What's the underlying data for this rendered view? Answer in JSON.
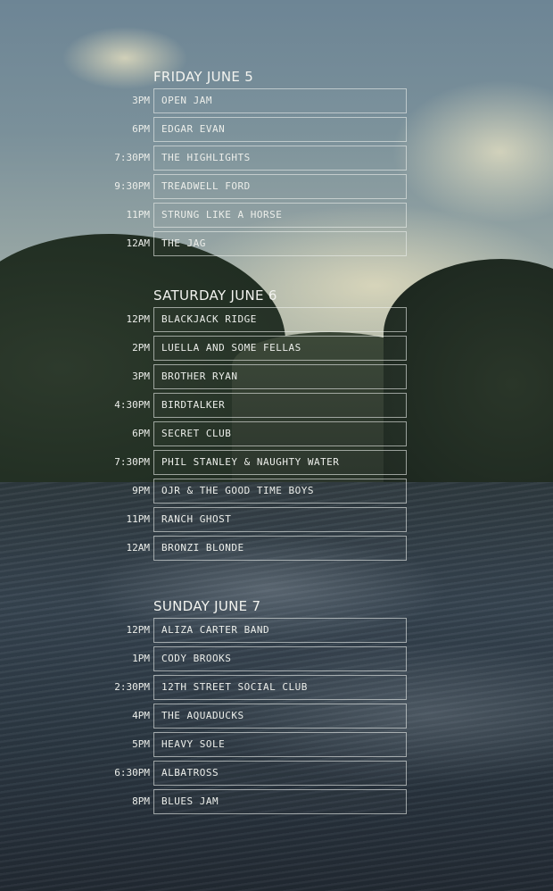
{
  "days": [
    {
      "title": "FRIDAY JUNE 5",
      "slots": [
        {
          "time": "3PM",
          "act": "OPEN JAM"
        },
        {
          "time": "6PM",
          "act": "EDGAR EVAN"
        },
        {
          "time": "7:30PM",
          "act": "THE HIGHLIGHTS"
        },
        {
          "time": "9:30PM",
          "act": "TREADWELL FORD"
        },
        {
          "time": "11PM",
          "act": "STRUNG LIKE A HORSE"
        },
        {
          "time": "12AM",
          "act": "THE JAG"
        }
      ]
    },
    {
      "title": "SATURDAY JUNE 6",
      "slots": [
        {
          "time": "12PM",
          "act": "BLACKJACK RIDGE"
        },
        {
          "time": "2PM",
          "act": "LUELLA AND SOME FELLAS"
        },
        {
          "time": "3PM",
          "act": "BROTHER RYAN"
        },
        {
          "time": "4:30PM",
          "act": "BIRDTALKER"
        },
        {
          "time": "6PM",
          "act": "SECRET CLUB"
        },
        {
          "time": "7:30PM",
          "act": "PHIL STANLEY & NAUGHTY WATER"
        },
        {
          "time": "9PM",
          "act": "OJR & THE GOOD TIME BOYS"
        },
        {
          "time": "11PM",
          "act": "RANCH GHOST"
        },
        {
          "time": "12AM",
          "act": "BRONZI BLONDE"
        }
      ]
    },
    {
      "title": "SUNDAY JUNE 7",
      "slots": [
        {
          "time": "12PM",
          "act": "ALIZA CARTER BAND"
        },
        {
          "time": "1PM",
          "act": "CODY BROOKS"
        },
        {
          "time": "2:30PM",
          "act": "12TH STREET SOCIAL CLUB"
        },
        {
          "time": "4PM",
          "act": "THE AQUADUCKS"
        },
        {
          "time": "5PM",
          "act": "HEAVY SOLE"
        },
        {
          "time": "6:30PM",
          "act": "ALBATROSS"
        },
        {
          "time": "8PM",
          "act": "BLUES JAM"
        }
      ]
    }
  ]
}
